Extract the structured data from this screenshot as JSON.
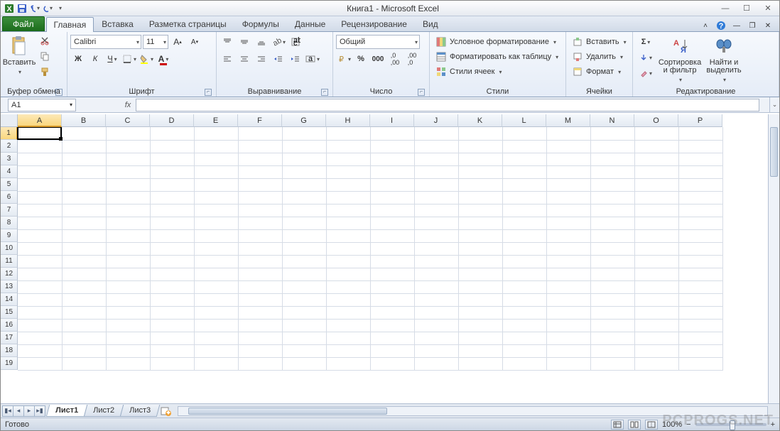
{
  "title": "Книга1 - Microsoft Excel",
  "qat": {
    "save": "save",
    "undo": "undo",
    "redo": "redo"
  },
  "tabs": {
    "file": "Файл",
    "items": [
      "Главная",
      "Вставка",
      "Разметка страницы",
      "Формулы",
      "Данные",
      "Рецензирование",
      "Вид"
    ],
    "active": 0
  },
  "ribbon": {
    "clipboard": {
      "paste": "Вставить",
      "label": "Буфер обмена"
    },
    "font": {
      "name": "Calibri",
      "size": "11",
      "label": "Шрифт"
    },
    "align": {
      "label": "Выравнивание"
    },
    "number": {
      "format": "Общий",
      "label": "Число"
    },
    "styles": {
      "cond": "Условное форматирование",
      "table": "Форматировать как таблицу",
      "cell": "Стили ячеек",
      "label": "Стили"
    },
    "cells": {
      "insert": "Вставить",
      "delete": "Удалить",
      "format": "Формат",
      "label": "Ячейки"
    },
    "editing": {
      "sort": "Сортировка и фильтр",
      "find": "Найти и выделить",
      "label": "Редактирование"
    }
  },
  "namebox": "A1",
  "fx": "fx",
  "columns": [
    "A",
    "B",
    "C",
    "D",
    "E",
    "F",
    "G",
    "H",
    "I",
    "J",
    "K",
    "L",
    "M",
    "N",
    "O",
    "P"
  ],
  "rows": [
    "1",
    "2",
    "3",
    "4",
    "5",
    "6",
    "7",
    "8",
    "9",
    "10",
    "11",
    "12",
    "13",
    "14",
    "15",
    "16",
    "17",
    "18",
    "19"
  ],
  "sheets": [
    "Лист1",
    "Лист2",
    "Лист3"
  ],
  "activesheet": 0,
  "status": "Готово",
  "zoom": "100%",
  "watermark": "PCPROGS.NET"
}
